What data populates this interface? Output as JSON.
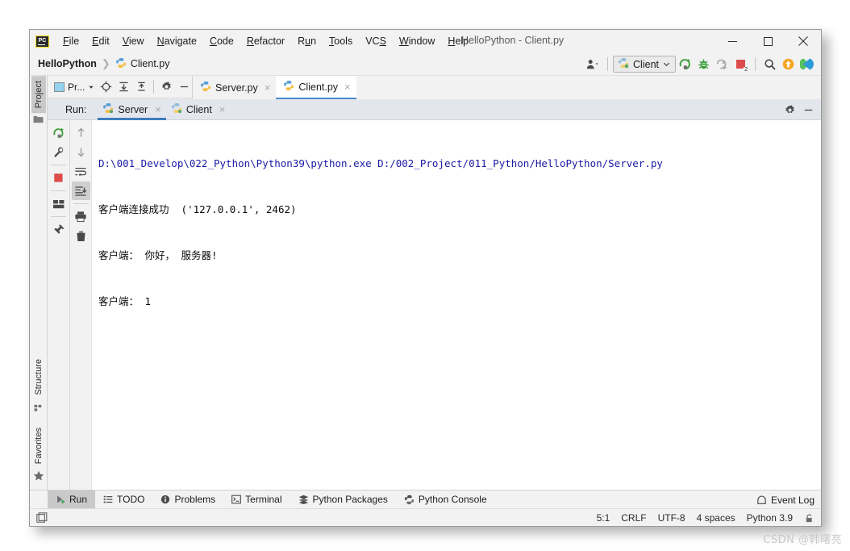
{
  "window": {
    "title": "HelloPython - Client.py",
    "logo_text": "PC",
    "controls": {
      "minimize": "minimize-icon",
      "maximize": "maximize-icon",
      "close": "close-icon"
    }
  },
  "menubar": {
    "items": [
      {
        "label": "File",
        "mnemonic": "F"
      },
      {
        "label": "Edit",
        "mnemonic": "E"
      },
      {
        "label": "View",
        "mnemonic": "V"
      },
      {
        "label": "Navigate",
        "mnemonic": "N"
      },
      {
        "label": "Code",
        "mnemonic": "C"
      },
      {
        "label": "Refactor",
        "mnemonic": "R"
      },
      {
        "label": "Run",
        "mnemonic": "u"
      },
      {
        "label": "Tools",
        "mnemonic": "T"
      },
      {
        "label": "VCS",
        "mnemonic": "S"
      },
      {
        "label": "Window",
        "mnemonic": "W"
      },
      {
        "label": "Help",
        "mnemonic": "H"
      }
    ]
  },
  "navbar": {
    "breadcrumb": {
      "project": "HelloPython",
      "separator": "❯",
      "file": "Client.py"
    },
    "run_config": {
      "label": "Client",
      "chevron": "⌄"
    },
    "icons": [
      "user-account-icon",
      "run-icon",
      "debug-icon",
      "coverage-icon",
      "stop-icon",
      "search-icon",
      "update-project-icon",
      "search-everywhere-icon"
    ],
    "stop_badge": "2"
  },
  "left_stripe": {
    "top": [
      {
        "label": "Project",
        "icon": "folder-icon",
        "active": true
      }
    ],
    "bottom": [
      {
        "label": "Structure",
        "icon": "structure-icon",
        "active": false
      },
      {
        "label": "Favorites",
        "icon": "star-icon",
        "active": false
      }
    ]
  },
  "project_panel": {
    "selector_label": "Pr...",
    "toolbar_icons": [
      "locate-icon",
      "expand-all-icon",
      "collapse-all-icon",
      "gear-icon",
      "minimize-icon"
    ]
  },
  "editor_tabs": [
    {
      "label": "Server.py",
      "icon": "python-file-icon",
      "active": false,
      "close": "×"
    },
    {
      "label": "Client.py",
      "icon": "python-file-icon",
      "active": true,
      "close": "×"
    }
  ],
  "run_window": {
    "label": "Run:",
    "tabs": [
      {
        "label": "Server",
        "icon": "python-run-icon",
        "active": true,
        "close": "×"
      },
      {
        "label": "Client",
        "icon": "python-run-icon",
        "active": false,
        "close": "×"
      }
    ],
    "header_icons": [
      "gear-icon",
      "minimize-icon"
    ],
    "gutter_left": [
      "rerun-icon",
      "wrench-icon",
      "stop-icon",
      "layout-icon",
      "pin-icon"
    ],
    "gutter_right": [
      "up-arrow-icon",
      "down-arrow-icon",
      "soft-wrap-icon",
      "scroll-to-end-icon",
      "print-icon",
      "trash-icon"
    ],
    "console_lines": [
      {
        "text": "D:\\001_Develop\\022_Python\\Python39\\python.exe D:/002_Project/011_Python/HelloPython/Server.py",
        "kind": "cmd"
      },
      {
        "text": "客户端连接成功  ('127.0.0.1', 2462)",
        "kind": "out"
      },
      {
        "text": "客户端： 你好， 服务器!",
        "kind": "out"
      },
      {
        "text": "客户端： 1",
        "kind": "out"
      }
    ]
  },
  "bottom_bar": {
    "tabs": [
      {
        "label": "Run",
        "icon": "run-icon",
        "active": true
      },
      {
        "label": "TODO",
        "icon": "todo-icon",
        "active": false
      },
      {
        "label": "Problems",
        "icon": "problems-icon",
        "active": false
      },
      {
        "label": "Terminal",
        "icon": "terminal-icon",
        "active": false
      },
      {
        "label": "Python Packages",
        "icon": "packages-icon",
        "active": false
      },
      {
        "label": "Python Console",
        "icon": "python-console-icon",
        "active": false
      }
    ],
    "event_log": {
      "label": "Event Log",
      "icon": "event-log-icon"
    }
  },
  "status_bar": {
    "toggle_icon": "toggle-toolwindows-icon",
    "caret": "5:1",
    "line_separator": "CRLF",
    "encoding": "UTF-8",
    "indent": "4 spaces",
    "interpreter": "Python 3.9",
    "lock_icon": "lock-icon"
  },
  "watermark": {
    "text": "CSDN @韩曙亮"
  },
  "colors": {
    "frame_bg": "#f2f2f2",
    "console_bg": "#ffffff",
    "cmd_text": "#1a1aa6",
    "out_text": "#0b0b0b",
    "tab_accent": "#3d7ebf",
    "run_green": "#3f9f3f",
    "stop_red": "#dd4b4b",
    "update_orange": "#f5a623",
    "runhdr_bg": "#e4e6ed"
  }
}
